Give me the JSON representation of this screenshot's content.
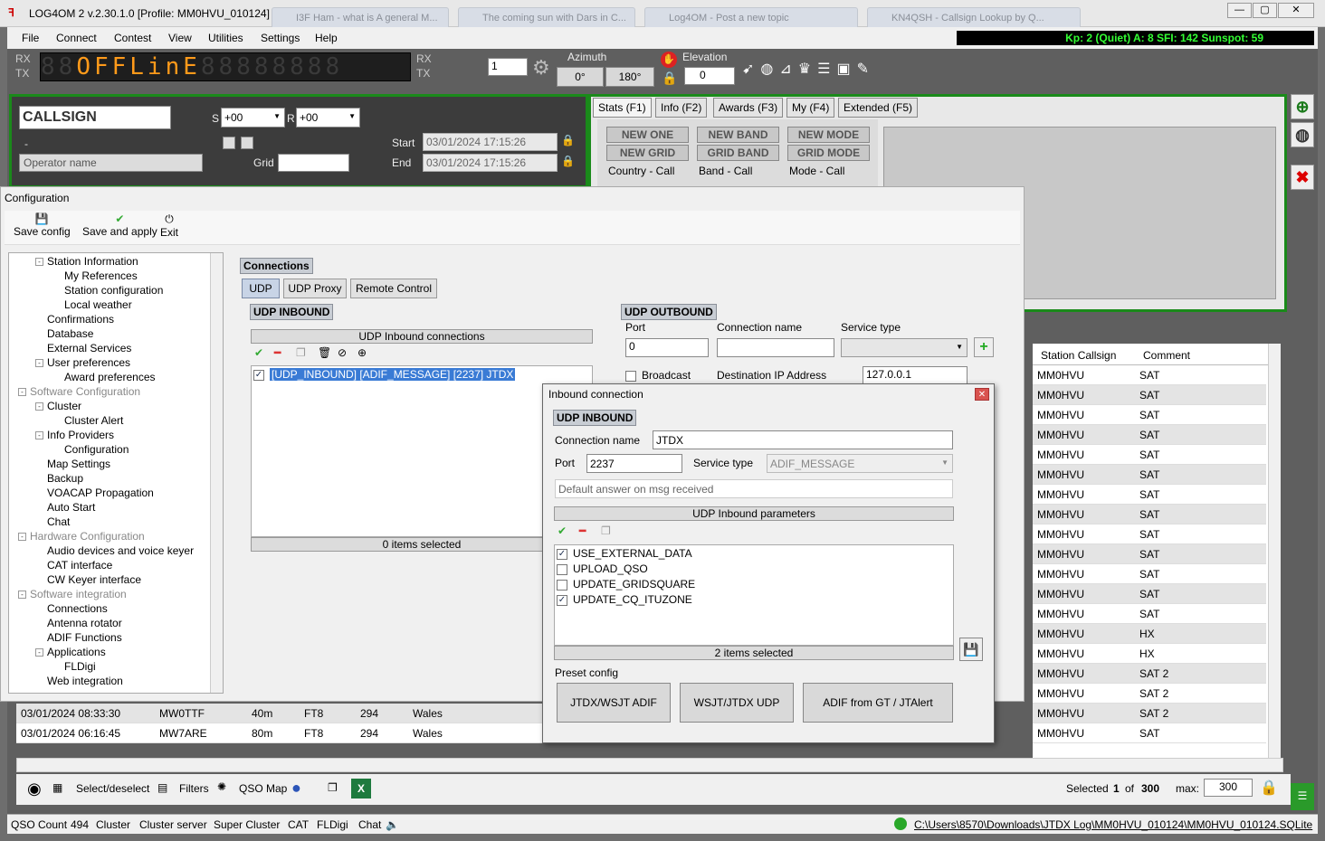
{
  "window": {
    "title": "LOG4OM 2 v.2.30.1.0 [Profile: MM0HVU_010124]",
    "bg_tabs": [
      "I3F Ham - what is A general M...",
      "The coming sun with Dars in C...",
      "Log4OM - Post a new topic",
      "KN4QSH - Callsign Lookup by Q..."
    ]
  },
  "menu": [
    "File",
    "Connect",
    "Contest",
    "View",
    "Utilities",
    "Settings",
    "Help"
  ],
  "kp": "Kp: 2 (Quiet)  A: 8  SFI: 142 Sunspot: 59",
  "toolbar": {
    "rx": "RX",
    "tx": "TX",
    "rx2": "RX",
    "tx2": "TX",
    "offline": "OFFLinE",
    "spinner": "1",
    "azimuth_label": "Azimuth",
    "az1": "0°",
    "az2": "180°",
    "elevation_label": "Elevation",
    "elevation": "0"
  },
  "qso": {
    "callsign": "CALLSIGN",
    "dash": "-",
    "s_label": "S",
    "s_value": "+00",
    "r_label": "R",
    "r_value": "+00",
    "operator_placeholder": "Operator name",
    "grid_label": "Grid",
    "start_label": "Start",
    "start_value": "03/01/2024 17:15:26",
    "end_label": "End",
    "end_value": "03/01/2024 17:15:26"
  },
  "stats": {
    "tabs": [
      "Stats (F1)",
      "Info (F2)",
      "Awards (F3)",
      "My (F4)",
      "Extended (F5)"
    ],
    "buttons": [
      "NEW ONE",
      "NEW BAND",
      "NEW MODE",
      "NEW GRID",
      "GRID BAND",
      "GRID MODE"
    ],
    "labels": [
      "Country - Call",
      "Band - Call",
      "Mode - Call"
    ]
  },
  "grid": {
    "headers": [
      "Station Callsign",
      "Comment"
    ],
    "rows": [
      [
        "MM0HVU",
        "SAT"
      ],
      [
        "MM0HVU",
        "SAT"
      ],
      [
        "MM0HVU",
        "SAT"
      ],
      [
        "MM0HVU",
        "SAT"
      ],
      [
        "MM0HVU",
        "SAT"
      ],
      [
        "MM0HVU",
        "SAT"
      ],
      [
        "MM0HVU",
        "SAT"
      ],
      [
        "MM0HVU",
        "SAT"
      ],
      [
        "MM0HVU",
        "SAT"
      ],
      [
        "MM0HVU",
        "SAT"
      ],
      [
        "MM0HVU",
        "SAT"
      ],
      [
        "MM0HVU",
        "SAT"
      ],
      [
        "MM0HVU",
        "SAT"
      ],
      [
        "MM0HVU",
        "HX"
      ],
      [
        "MM0HVU",
        "HX"
      ],
      [
        "MM0HVU",
        "SAT 2"
      ],
      [
        "MM0HVU",
        "SAT 2"
      ],
      [
        "MM0HVU",
        "SAT 2"
      ],
      [
        "MM0HVU",
        "SAT"
      ]
    ]
  },
  "log": [
    [
      "03/01/2024 08:33:30",
      "MW0TTF",
      "40m",
      "FT8",
      "294",
      "Wales"
    ],
    [
      "03/01/2024 06:16:45",
      "MW7ARE",
      "80m",
      "FT8",
      "294",
      "Wales"
    ]
  ],
  "config": {
    "title": "Configuration",
    "toolbar": [
      "Save config",
      "Save and apply",
      "Exit"
    ],
    "tree": [
      {
        "t": "Station Information",
        "l": 1,
        "exp": "-"
      },
      {
        "t": "My References",
        "l": 2
      },
      {
        "t": "Station configuration",
        "l": 2
      },
      {
        "t": "Local weather",
        "l": 2
      },
      {
        "t": "Confirmations",
        "l": 1
      },
      {
        "t": "Database",
        "l": 1
      },
      {
        "t": "External Services",
        "l": 1
      },
      {
        "t": "User preferences",
        "l": 1,
        "exp": "-"
      },
      {
        "t": "Award preferences",
        "l": 2
      },
      {
        "t": "Software Configuration",
        "l": 0,
        "exp": "-",
        "g": true
      },
      {
        "t": "Cluster",
        "l": 1,
        "exp": "-"
      },
      {
        "t": "Cluster Alert",
        "l": 2
      },
      {
        "t": "Info Providers",
        "l": 1,
        "exp": "-"
      },
      {
        "t": "Configuration",
        "l": 2
      },
      {
        "t": "Map Settings",
        "l": 1
      },
      {
        "t": "Backup",
        "l": 1
      },
      {
        "t": "VOACAP Propagation",
        "l": 1
      },
      {
        "t": "Auto Start",
        "l": 1
      },
      {
        "t": "Chat",
        "l": 1
      },
      {
        "t": "Hardware Configuration",
        "l": 0,
        "exp": "-",
        "g": true
      },
      {
        "t": "Audio devices and voice keyer",
        "l": 1
      },
      {
        "t": "CAT interface",
        "l": 1
      },
      {
        "t": "CW Keyer interface",
        "l": 1
      },
      {
        "t": "Software integration",
        "l": 0,
        "exp": "-",
        "g": true
      },
      {
        "t": "Connections",
        "l": 1
      },
      {
        "t": "Antenna rotator",
        "l": 1
      },
      {
        "t": "ADIF Functions",
        "l": 1
      },
      {
        "t": "Applications",
        "l": 1,
        "exp": "-"
      },
      {
        "t": "FLDigi",
        "l": 2
      },
      {
        "t": "Web integration",
        "l": 1
      }
    ],
    "connections_label": "Connections",
    "tabs": [
      "UDP",
      "UDP Proxy",
      "Remote Control"
    ],
    "inbound_label": "UDP INBOUND",
    "inbound_header": "UDP Inbound connections",
    "inbound_item": "[UDP_INBOUND] [ADIF_MESSAGE] [2237] JTDX",
    "inbound_footer": "0 items selected",
    "outbound_label": "UDP OUTBOUND",
    "port_label": "Port",
    "port_value": "0",
    "conn_name_label": "Connection name",
    "service_type_label": "Service type",
    "broadcast_label": "Broadcast",
    "dest_ip_label": "Destination IP Address",
    "dest_ip": "127.0.0.1"
  },
  "dialog": {
    "title": "Inbound connection",
    "section": "UDP INBOUND",
    "conn_name_label": "Connection name",
    "conn_name": "JTDX",
    "port_label": "Port",
    "port": "2237",
    "service_label": "Service type",
    "service": "ADIF_MESSAGE",
    "default_answer": "Default answer on msg received",
    "params_header": "UDP Inbound parameters",
    "params": [
      {
        "name": "USE_EXTERNAL_DATA",
        "checked": true
      },
      {
        "name": "UPLOAD_QSO",
        "checked": false
      },
      {
        "name": "UPDATE_GRIDSQUARE",
        "checked": false
      },
      {
        "name": "UPDATE_CQ_ITUZONE",
        "checked": true
      }
    ],
    "params_footer": "2 items selected",
    "preset_label": "Preset config",
    "presets": [
      "JTDX/WSJT ADIF",
      "WSJT/JTDX UDP",
      "ADIF from GT / JTAlert"
    ]
  },
  "bottom": {
    "select": "Select/deselect",
    "filters": "Filters",
    "qso_map": "QSO Map",
    "selected_label": "Selected",
    "selected": "1",
    "of": "of",
    "total": "300",
    "max_label": "max:",
    "max": "300"
  },
  "status": {
    "qso_count_label": "QSO Count",
    "qso_count": "494",
    "items": [
      "Cluster",
      "Cluster server",
      "Super Cluster",
      "CAT",
      "FLDigi",
      "Chat"
    ],
    "path": "C:\\Users\\8570\\Downloads\\JTDX Log\\MM0HVU_010124\\MM0HVU_010124.SQLite"
  }
}
